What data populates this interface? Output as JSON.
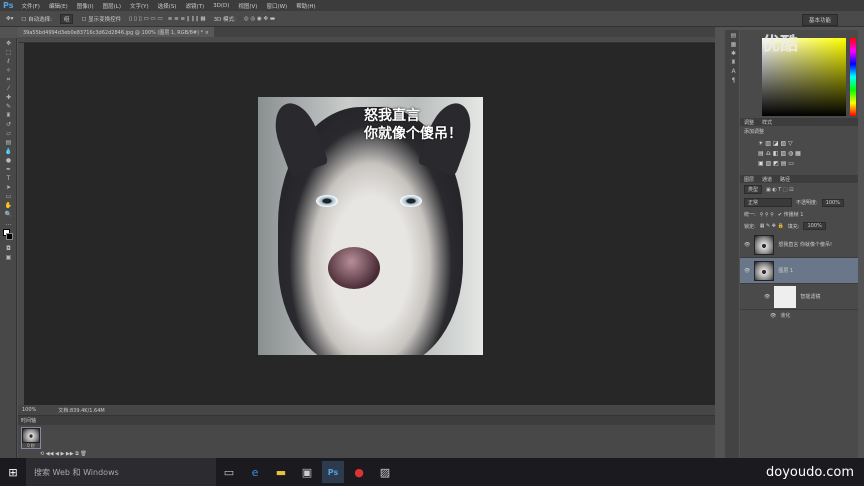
{
  "app": {
    "logo": "Ps",
    "workspace": "基本功能"
  },
  "menu": [
    "文件(F)",
    "编辑(E)",
    "图像(I)",
    "图层(L)",
    "文字(Y)",
    "选择(S)",
    "滤镜(T)",
    "3D(D)",
    "视图(V)",
    "窗口(W)",
    "帮助(H)"
  ],
  "options": {
    "auto_select": "自动选择:",
    "auto_select_value": "组",
    "show_transform": "显示变换控件",
    "mode3d": "3D 模式:"
  },
  "document": {
    "tab": "39a55bd4994d3eb0e83716c3d62d2846.jpg @ 100% (图层 1, RGB/8#) *",
    "zoom": "100%",
    "doc_size": "文档:839.4K/1.64M"
  },
  "image_text": {
    "line1": "怒我直言",
    "line2": "你就像个傻吊！"
  },
  "timeline": {
    "title": "时间轴",
    "frame_time": "0 秒"
  },
  "panels": {
    "adjust_tabs": [
      "调整",
      "样式"
    ],
    "add_adjust": "添加调整",
    "layer_tabs": [
      "图层",
      "通道",
      "路径"
    ],
    "filter_kind": "类型",
    "blend": "正常",
    "opacity_label": "不透明度:",
    "opacity": "100%",
    "unify": "统一:",
    "propagate": "传播帧 1",
    "lock": "锁定:",
    "fill_label": "填充:",
    "fill": "100%",
    "layers": [
      {
        "name": "怒我直言 你就像个傻吊!"
      },
      {
        "name": "图层 1"
      },
      {
        "name": "智能滤镜"
      },
      {
        "name": "液化"
      }
    ]
  },
  "taskbar": {
    "search": "搜索 Web 和 Windows"
  },
  "watermark": {
    "youku": "优酷",
    "site": "doyoudo.com"
  }
}
